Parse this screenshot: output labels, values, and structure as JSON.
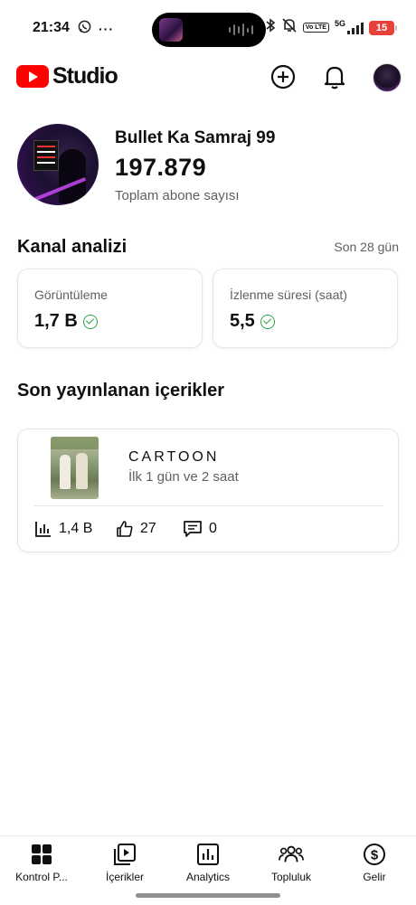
{
  "status_bar": {
    "time": "21:34",
    "left_icons": [
      "whatsapp-icon",
      "more-dots-icon"
    ],
    "right_icons": [
      "bluetooth-icon",
      "mute-icon",
      "volte-icon",
      "5g-signal-icon",
      "battery-icon"
    ],
    "volte_label": "Vo LTE",
    "network": "5G",
    "battery": "15"
  },
  "header": {
    "app_name": "Studio",
    "actions": [
      "create-icon",
      "notifications-icon",
      "account-avatar"
    ]
  },
  "channel": {
    "name": "Bullet Ka Samraj 99",
    "subscribers": "197.879",
    "subscribers_label": "Toplam abone sayısı"
  },
  "analytics": {
    "title": "Kanal analizi",
    "period": "Son 28 gün",
    "stats": [
      {
        "label": "Görüntüleme",
        "value": "1,7 B"
      },
      {
        "label": "İzlenme süresi (saat)",
        "value": "5,5"
      }
    ]
  },
  "recent": {
    "title": "Son yayınlanan içerikler",
    "item": {
      "title": "CARTOON",
      "meta": "İlk 1 gün ve 2 saat",
      "views": "1,4 B",
      "likes": "27",
      "comments": "0"
    }
  },
  "bottom_nav": [
    {
      "label": "Kontrol P...",
      "icon": "dashboard-icon"
    },
    {
      "label": "İçerikler",
      "icon": "content-icon"
    },
    {
      "label": "Analytics",
      "icon": "analytics-icon"
    },
    {
      "label": "Topluluk",
      "icon": "community-icon"
    },
    {
      "label": "Gelir",
      "icon": "earn-icon"
    }
  ],
  "colors": {
    "brand": "#ff0000",
    "check": "#2e9f45",
    "secondary_text": "#606060"
  }
}
